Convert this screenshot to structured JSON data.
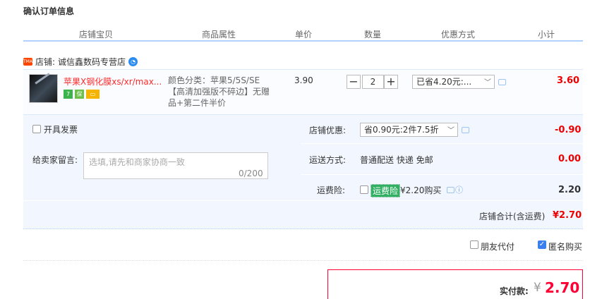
{
  "page": {
    "title": "确认订单信息"
  },
  "columns": [
    "店铺宝贝",
    "商品属性",
    "单价",
    "数量",
    "优惠方式",
    "小计"
  ],
  "store": {
    "badge": "TMALL",
    "label": "店铺:",
    "name": "诚信鑫数码专营店"
  },
  "item": {
    "name": "苹果X钢化膜xs/xr/max...",
    "attr_line1": "颜色分类：苹果5/5S/SE",
    "attr_line2": "【高清加强版不碎边】无赠",
    "attr_line3": "品+第二件半价",
    "price": "3.90",
    "qty": "2",
    "qty_minus": "−",
    "qty_plus": "+",
    "promo": "已省4.20元:...",
    "subtotal": "3.60",
    "icons": [
      "7-day-return-icon",
      "guarantee-icon",
      "credit-card-icon"
    ]
  },
  "invoice": {
    "label": "开具发票"
  },
  "message": {
    "label": "给卖家留言:",
    "placeholder": "选填,请先和商家协商一致",
    "counter": "0/200"
  },
  "store_discount": {
    "label": "店铺优惠:",
    "value": "省0.90元:2件7.5折",
    "amount": "-0.90"
  },
  "shipping": {
    "label": "运送方式:",
    "value": "普通配送 快递 免邮",
    "amount": "0.00"
  },
  "insurance": {
    "label": "运费险:",
    "badge": "运费险",
    "text": "¥2.20购买",
    "amount": "2.20"
  },
  "store_total": {
    "label": "店铺合计(含运费)",
    "amount": "¥2.70"
  },
  "options": {
    "friend_pay": "朋友代付",
    "anonymous": "匿名购买",
    "anonymous_checked": true,
    "friend_checked": false
  },
  "payment": {
    "label": "实付款:",
    "currency": "¥",
    "amount": "2.70"
  },
  "colors": {
    "accent": "#ff0036",
    "panel": "#f2f7ff",
    "header_line": "#b2d1ff"
  }
}
